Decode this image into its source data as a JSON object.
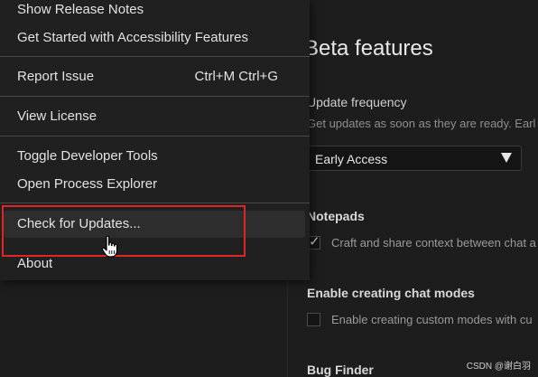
{
  "help_menu": {
    "items": [
      {
        "label": "Show Release Notes",
        "shortcut": ""
      },
      {
        "label": "Get Started with Accessibility Features",
        "shortcut": ""
      },
      {
        "label": "Report Issue",
        "shortcut": "Ctrl+M Ctrl+G"
      },
      {
        "label": "View License",
        "shortcut": ""
      },
      {
        "label": "Toggle Developer Tools",
        "shortcut": ""
      },
      {
        "label": "Open Process Explorer",
        "shortcut": ""
      },
      {
        "label": "Check for Updates...",
        "shortcut": ""
      },
      {
        "label": "About",
        "shortcut": ""
      }
    ],
    "highlighted_item": "Check for Updates...",
    "highlight_color": "#e02525"
  },
  "settings": {
    "section_title": "Beta features",
    "update_frequency": {
      "label": "Update frequency",
      "description": "Get updates as soon as they are ready. Earl",
      "selected": "Early Access"
    },
    "notepads": {
      "label": "Notepads",
      "checkbox_text": "Craft and share context between chat a",
      "checked": true
    },
    "chat_modes": {
      "label": "Enable creating chat modes",
      "checkbox_text": "Enable creating custom modes with cu",
      "checked": false
    },
    "bug_finder": {
      "label": "Bug Finder"
    }
  },
  "icons": {
    "cursor": "hand-pointer-icon",
    "caret": "caret-down-icon",
    "check": "checkmark-icon"
  },
  "watermark": "CSDN @谢白羽"
}
